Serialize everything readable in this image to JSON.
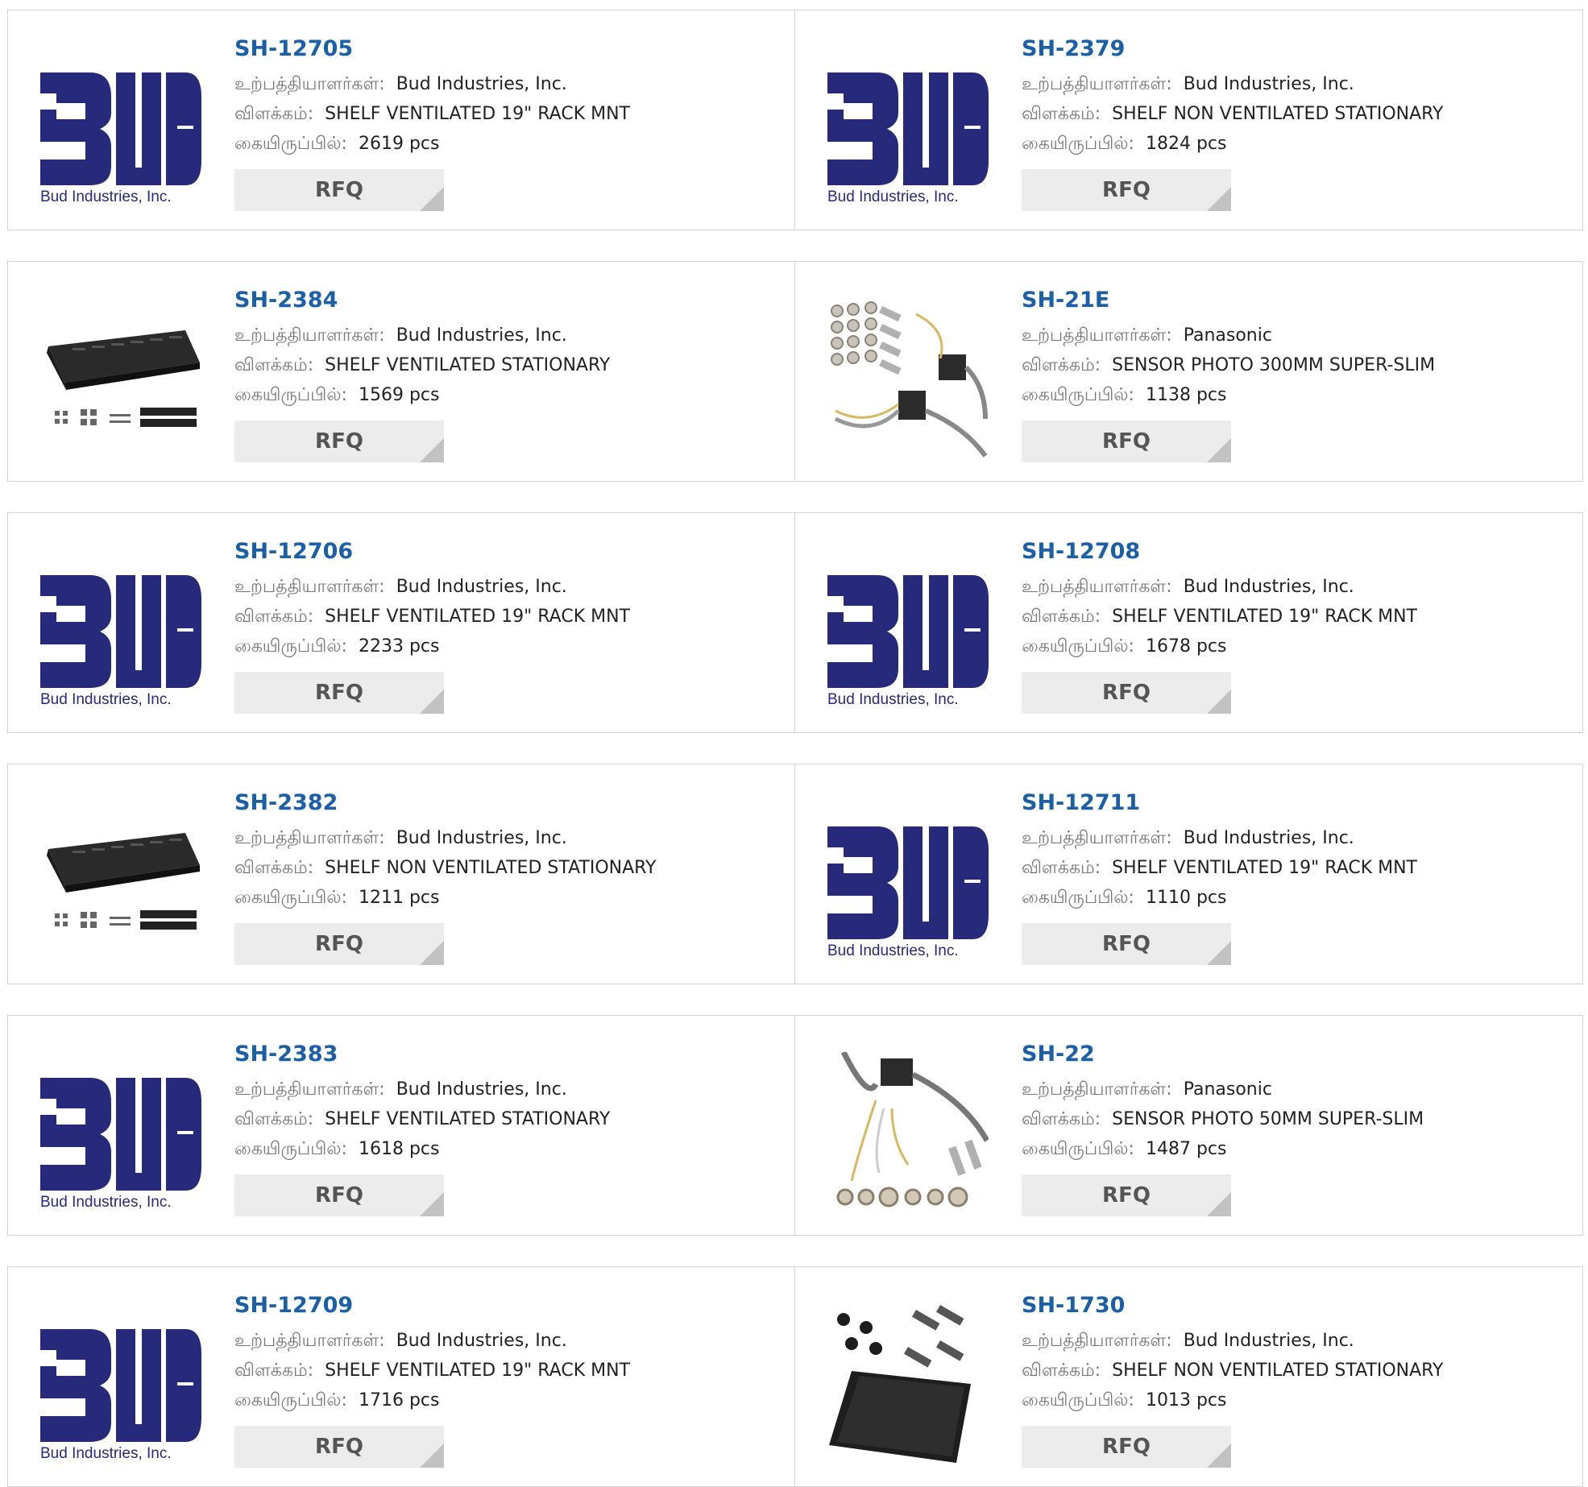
{
  "labels": {
    "manufacturer": "உற்பத்தியாளர்கள்:",
    "description": "விளக்கம்:",
    "stock": "கையிருப்பில்:",
    "rfq": "RFQ"
  },
  "logo_text": "Bud Industries, Inc.",
  "colors": {
    "link": "#1a5fa8",
    "bud_logo": "#27297a",
    "rfq_bg": "#ececec"
  },
  "products": [
    {
      "part": "SH-12705",
      "manufacturer": "Bud Industries, Inc.",
      "description": "SHELF VENTILATED 19\" RACK MNT",
      "stock": "2619 pcs",
      "image": "bud-logo"
    },
    {
      "part": "SH-2379",
      "manufacturer": "Bud Industries, Inc.",
      "description": "SHELF NON VENTILATED STATIONARY",
      "stock": "1824 pcs",
      "image": "bud-logo"
    },
    {
      "part": "SH-2384",
      "manufacturer": "Bud Industries, Inc.",
      "description": "SHELF VENTILATED STATIONARY",
      "stock": "1569 pcs",
      "image": "shelf"
    },
    {
      "part": "SH-21E",
      "manufacturer": "Panasonic",
      "description": "SENSOR PHOTO 300MM SUPER-SLIM",
      "stock": "1138 pcs",
      "image": "sensor"
    },
    {
      "part": "SH-12706",
      "manufacturer": "Bud Industries, Inc.",
      "description": "SHELF VENTILATED 19\" RACK MNT",
      "stock": "2233 pcs",
      "image": "bud-logo"
    },
    {
      "part": "SH-12708",
      "manufacturer": "Bud Industries, Inc.",
      "description": "SHELF VENTILATED 19\" RACK MNT",
      "stock": "1678 pcs",
      "image": "bud-logo"
    },
    {
      "part": "SH-2382",
      "manufacturer": "Bud Industries, Inc.",
      "description": "SHELF NON VENTILATED STATIONARY",
      "stock": "1211 pcs",
      "image": "shelf"
    },
    {
      "part": "SH-12711",
      "manufacturer": "Bud Industries, Inc.",
      "description": "SHELF VENTILATED 19\" RACK MNT",
      "stock": "1110 pcs",
      "image": "bud-logo"
    },
    {
      "part": "SH-2383",
      "manufacturer": "Bud Industries, Inc.",
      "description": "SHELF VENTILATED STATIONARY",
      "stock": "1618 pcs",
      "image": "bud-logo"
    },
    {
      "part": "SH-22",
      "manufacturer": "Panasonic",
      "description": "SENSOR PHOTO 50MM SUPER-SLIM",
      "stock": "1487 pcs",
      "image": "sensor2"
    },
    {
      "part": "SH-12709",
      "manufacturer": "Bud Industries, Inc.",
      "description": "SHELF VENTILATED 19\" RACK MNT",
      "stock": "1716 pcs",
      "image": "bud-logo"
    },
    {
      "part": "SH-1730",
      "manufacturer": "Bud Industries, Inc.",
      "description": "SHELF NON VENTILATED STATIONARY",
      "stock": "1013 pcs",
      "image": "tray"
    }
  ]
}
